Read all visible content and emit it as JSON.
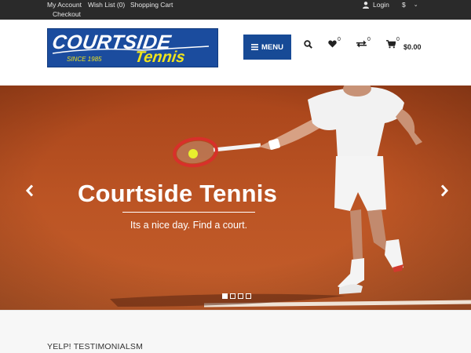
{
  "topbar": {
    "account": "My Account",
    "wishlist": "Wish List (0)",
    "cart": "Shopping Cart",
    "checkout": "Checkout",
    "login": "Login",
    "currency": "$"
  },
  "header": {
    "logo_line1": "COURTSIDE",
    "logo_line2": "Tennis",
    "logo_since": "SINCE 1985",
    "menu_label": "MENU",
    "wishlist_count": "0",
    "compare_count": "0",
    "cart_count": "0",
    "cart_total": "$0.00"
  },
  "hero": {
    "title": "Courtside Tennis",
    "subtitle": "Its a nice day. Find a court."
  },
  "testimonials": {
    "title": "YELP! TESTIMONIALSM"
  },
  "colors": {
    "menu_button": "#174a96",
    "logo_blue": "#1b4c9e",
    "logo_yellow": "#f0e41c",
    "clay": "#b24c1e",
    "topbar": "#2a2a2a"
  },
  "icons": [
    "user-icon",
    "chevron-down-icon",
    "bars-icon",
    "search-icon",
    "heart-icon",
    "compare-icon",
    "cart-icon",
    "chevron-left-icon",
    "chevron-right-icon"
  ]
}
